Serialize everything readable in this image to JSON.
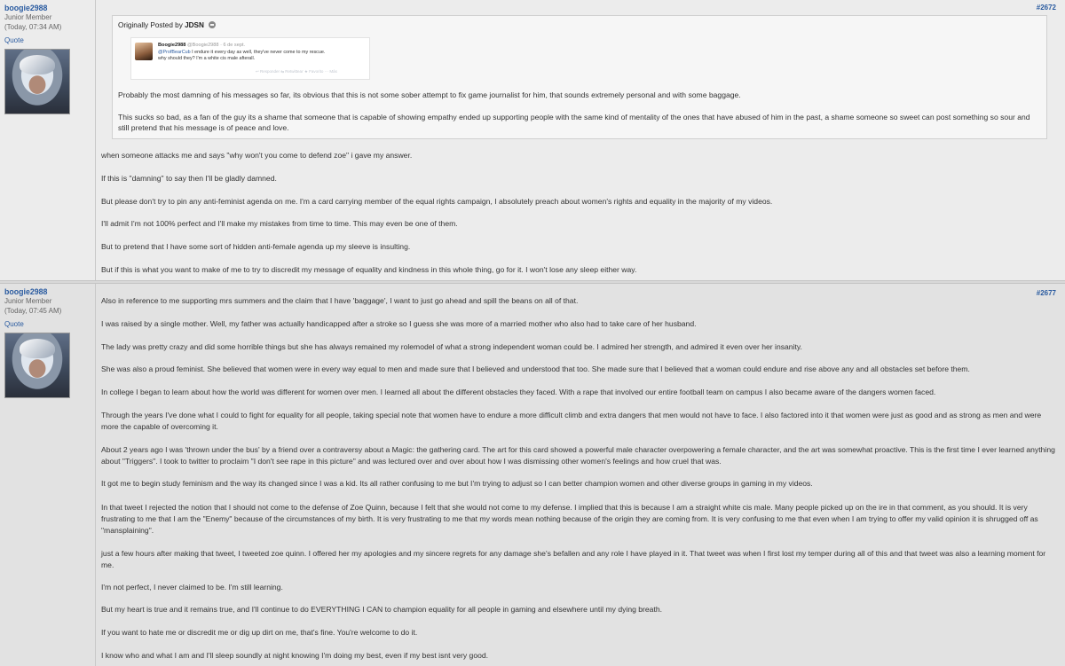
{
  "post1": {
    "username": "boogie2988",
    "usertitle": "Junior Member",
    "posttime": "(Today, 07:34 AM)",
    "quote_link": "Quote",
    "postnum": "#2672",
    "quote": {
      "originally_posted_by": "Originally Posted by",
      "author": "JDSN",
      "tweet": {
        "name": "Boogie2988",
        "handle": "@Boogie2988 · 6 de sept.",
        "mention": "@ProfBearCub",
        "text_line1": " I endure it every day as well, they've never come to my rescue.",
        "text_line2": "why should they? I'm a white cis male afterall.",
        "actions": "↩ Responder   ⇆ Retwittear   ★ Favorito   ··· Más"
      },
      "para1": "Probably the most damning of his messages so far, its obvious that this is not some sober attempt to fix game journalist for him, that sounds extremely personal and with some baggage.",
      "para2": "This sucks so bad, as a fan of the guy its a shame that someone that is capable of showing empathy ended up supporting people with the same kind of mentality of the ones that have abused of him in the past, a shame someone so sweet can post something so sour and still pretend that his message is of peace and love."
    },
    "paragraphs": [
      "when someone attacks me and says \"why won't you come to defend zoe\" i gave my answer.",
      "If this is \"damning\" to say then I'll be gladly damned.",
      "But please don't try to pin any anti-feminist agenda on me. I'm a card carrying member of the equal rights campaign, I absolutely preach about women's rights and equality in the majority of my videos.",
      "I'll admit I'm not 100% perfect and I'll make my mistakes from time to time. This may even be one of them.",
      "But to pretend that I have some sort of hidden anti-female agenda up my sleeve is insulting.",
      "But if this is what you want to make of me to try to discredit my message of equality and kindness in this whole thing, go for it. I won't lose any sleep either way."
    ]
  },
  "post2": {
    "username": "boogie2988",
    "usertitle": "Junior Member",
    "posttime": "(Today, 07:45 AM)",
    "quote_link": "Quote",
    "postnum": "#2677",
    "paragraphs": [
      "Also in reference to me supporting mrs summers and the claim that I have 'baggage', I want to just go ahead and spill the beans on all of that.",
      "I was raised by a single mother. Well, my father was actually handicapped after a stroke so I guess she was more of a married mother who also had to take care of her husband.",
      "The lady was pretty crazy and did some horrible things but she has always remained my rolemodel of what a strong independent woman could be. I admired her strength, and admired it even over her insanity.",
      "She was also a proud feminist. She believed that women were in every way equal to men and made sure that I believed and understood that too. She made sure that I believed that a woman could endure and rise above any and all obstacles set before them.",
      "In college I began to learn about how the world was different for women over men. I learned all about the different obstacles they faced. With a rape that involved our entire football team on campus I also became aware of the dangers women faced.",
      "Through the years I've done what I could to fight for equality for all people, taking special note that women have to endure a more difficult climb and extra dangers that men would not have to face. I also factored into it that women were just as good and as strong as men and were more the capable of overcoming it.",
      "About 2 years ago I was 'thrown under the bus' by a friend over a contraversy about a Magic: the gathering card. The art for this card showed a powerful male character overpowering a female character, and the art was somewhat proactive. This is the first time I ever learned anything about \"Triggers\". I took to twitter to proclaim \"I don't see rape in this picture\" and was lectured over and over about how I was dismissing other women's feelings and how cruel that was.",
      "It got me to begin study feminism and the way its changed since I was a kid. Its all rather confusing to me but I'm trying to adjust so I can better champion women and other diverse groups in gaming in my videos.",
      "In that tweet I rejected the notion that I should not come to the defense of Zoe Quinn, because I felt that she would not come to my defense. I implied that this is because I am a straight white cis male. Many people picked up on the ire in that comment, as you should. It is very frustrating to me that I am the \"Enemy\" because of the circumstances of my birth. It is very frustrating to me that my words mean nothing because of the origin they are coming from. It is very confusing to me that even when I am trying to offer my valid opinion it is shrugged off as \"mansplaining\".",
      "just a few hours after making that tweet, I tweeted zoe quinn. I offered her my apologies and my sincere regrets for any damage she's befallen and any role I have played in it. That tweet was when I first lost my temper during all of this and that tweet was also a learning moment for me.",
      "I'm not perfect, I never claimed to be. I'm still learning.",
      "But my heart is true and it remains true, and I'll continue to do EVERYTHING I CAN to champion equality for all people in gaming and elsewhere until my dying breath.",
      "If you want to hate me or discredit me or dig up dirt on me, that's fine. You're welcome to do it.",
      "I know who and what I am and I'll sleep soundly at night knowing I'm doing my best, even if my best isnt very good."
    ]
  }
}
